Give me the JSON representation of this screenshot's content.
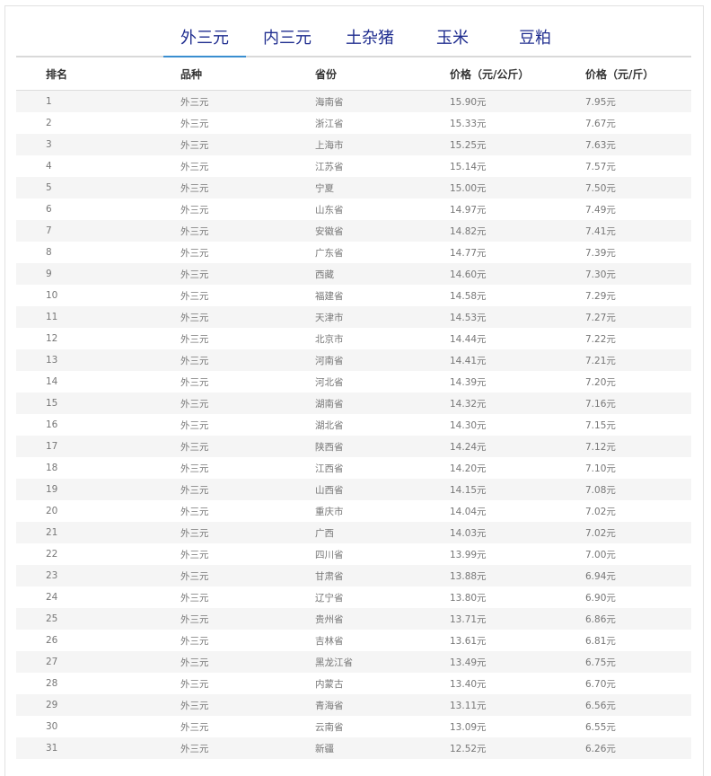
{
  "tabs": [
    {
      "label": "外三元",
      "active": true
    },
    {
      "label": "内三元",
      "active": false
    },
    {
      "label": "土杂猪",
      "active": false
    },
    {
      "label": "玉米",
      "active": false
    },
    {
      "label": "豆粕",
      "active": false
    }
  ],
  "table": {
    "headers": [
      "排名",
      "品种",
      "省份",
      "价格（元/公斤）",
      "价格（元/斤）"
    ],
    "rows": [
      [
        "1",
        "外三元",
        "海南省",
        "15.90元",
        "7.95元"
      ],
      [
        "2",
        "外三元",
        "浙江省",
        "15.33元",
        "7.67元"
      ],
      [
        "3",
        "外三元",
        "上海市",
        "15.25元",
        "7.63元"
      ],
      [
        "4",
        "外三元",
        "江苏省",
        "15.14元",
        "7.57元"
      ],
      [
        "5",
        "外三元",
        "宁夏",
        "15.00元",
        "7.50元"
      ],
      [
        "6",
        "外三元",
        "山东省",
        "14.97元",
        "7.49元"
      ],
      [
        "7",
        "外三元",
        "安徽省",
        "14.82元",
        "7.41元"
      ],
      [
        "8",
        "外三元",
        "广东省",
        "14.77元",
        "7.39元"
      ],
      [
        "9",
        "外三元",
        "西藏",
        "14.60元",
        "7.30元"
      ],
      [
        "10",
        "外三元",
        "福建省",
        "14.58元",
        "7.29元"
      ],
      [
        "11",
        "外三元",
        "天津市",
        "14.53元",
        "7.27元"
      ],
      [
        "12",
        "外三元",
        "北京市",
        "14.44元",
        "7.22元"
      ],
      [
        "13",
        "外三元",
        "河南省",
        "14.41元",
        "7.21元"
      ],
      [
        "14",
        "外三元",
        "河北省",
        "14.39元",
        "7.20元"
      ],
      [
        "15",
        "外三元",
        "湖南省",
        "14.32元",
        "7.16元"
      ],
      [
        "16",
        "外三元",
        "湖北省",
        "14.30元",
        "7.15元"
      ],
      [
        "17",
        "外三元",
        "陕西省",
        "14.24元",
        "7.12元"
      ],
      [
        "18",
        "外三元",
        "江西省",
        "14.20元",
        "7.10元"
      ],
      [
        "19",
        "外三元",
        "山西省",
        "14.15元",
        "7.08元"
      ],
      [
        "20",
        "外三元",
        "重庆市",
        "14.04元",
        "7.02元"
      ],
      [
        "21",
        "外三元",
        "广西",
        "14.03元",
        "7.02元"
      ],
      [
        "22",
        "外三元",
        "四川省",
        "13.99元",
        "7.00元"
      ],
      [
        "23",
        "外三元",
        "甘肃省",
        "13.88元",
        "6.94元"
      ],
      [
        "24",
        "外三元",
        "辽宁省",
        "13.80元",
        "6.90元"
      ],
      [
        "25",
        "外三元",
        "贵州省",
        "13.71元",
        "6.86元"
      ],
      [
        "26",
        "外三元",
        "吉林省",
        "13.61元",
        "6.81元"
      ],
      [
        "27",
        "外三元",
        "黑龙江省",
        "13.49元",
        "6.75元"
      ],
      [
        "28",
        "外三元",
        "内蒙古",
        "13.40元",
        "6.70元"
      ],
      [
        "29",
        "外三元",
        "青海省",
        "13.11元",
        "6.56元"
      ],
      [
        "30",
        "外三元",
        "云南省",
        "13.09元",
        "6.55元"
      ],
      [
        "31",
        "外三元",
        "新疆",
        "12.52元",
        "6.26元"
      ]
    ]
  }
}
